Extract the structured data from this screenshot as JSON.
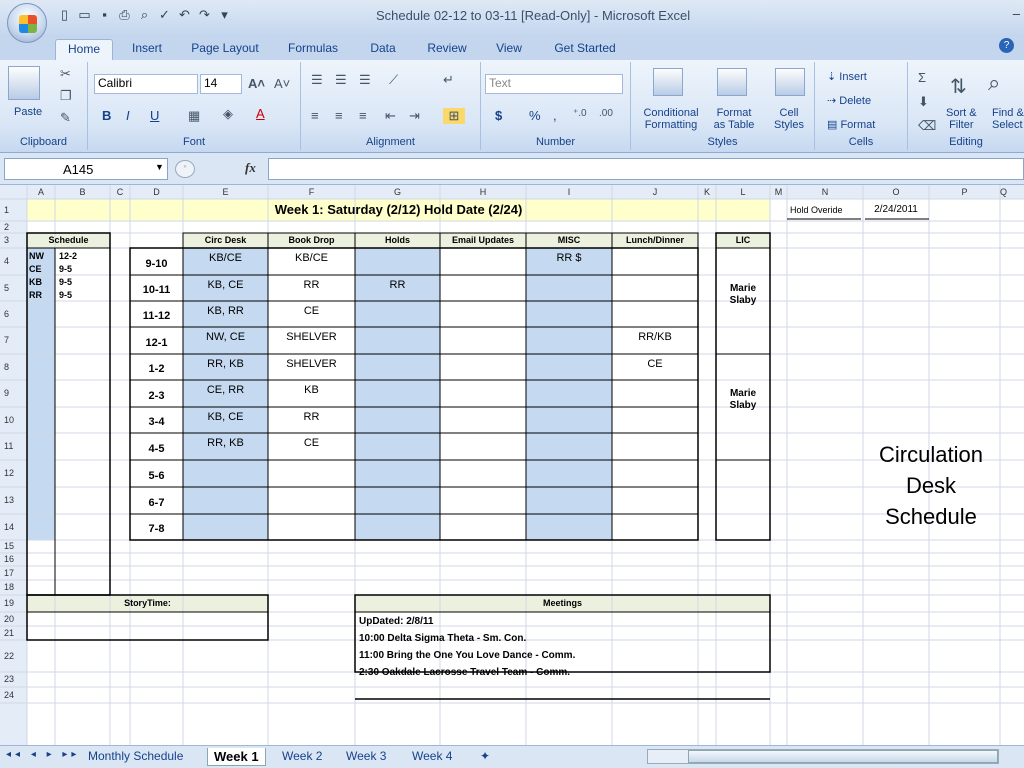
{
  "window": {
    "title": "Schedule 02-12 to 03-11  [Read-Only] - Microsoft Excel",
    "min": "–"
  },
  "tabs": [
    "Home",
    "Insert",
    "Page Layout",
    "Formulas",
    "Data",
    "Review",
    "View",
    "Get Started"
  ],
  "ribbon": {
    "clipboard": {
      "label": "Clipboard",
      "paste": "Paste"
    },
    "font": {
      "label": "Font",
      "name": "Calibri",
      "size": "14",
      "bold": "B",
      "italic": "I",
      "underline": "U"
    },
    "alignment": {
      "label": "Alignment"
    },
    "number": {
      "label": "Number",
      "format": "Text",
      "currency": "$",
      "percent": "%",
      "comma": ","
    },
    "styles": {
      "label": "Styles",
      "conditional": [
        "Conditional",
        "Formatting"
      ],
      "format_table": [
        "Format",
        "as Table"
      ],
      "cell_styles": [
        "Cell",
        "Styles"
      ]
    },
    "cells": {
      "label": "Cells",
      "insert": "Insert",
      "delete": "Delete",
      "format": "Format"
    },
    "editing": {
      "label": "Editing",
      "sort": [
        "Sort &",
        "Filter"
      ],
      "find": [
        "Find &",
        "Select"
      ]
    }
  },
  "formula_bar": {
    "name_box": "A145",
    "fx": "fx",
    "content": ""
  },
  "columns": [
    "A",
    "B",
    "C",
    "D",
    "E",
    "F",
    "G",
    "H",
    "I",
    "J",
    "K",
    "L",
    "M",
    "N",
    "O",
    "P",
    "Q"
  ],
  "rows": [
    "1",
    "2",
    "3",
    "4",
    "5",
    "6",
    "7",
    "8",
    "9",
    "10",
    "11",
    "12",
    "13",
    "14",
    "15",
    "16",
    "17",
    "18",
    "19",
    "20",
    "21",
    "22",
    "23",
    "24"
  ],
  "sheet": {
    "title": "Week 1: Saturday (2/12)   Hold Date (2/24)",
    "hold_override_label": "Hold Overide",
    "hold_override_value": "2/24/2011",
    "schedule_header": "Schedule",
    "staff": [
      [
        "NW",
        "12-2"
      ],
      [
        "CE",
        "9-5"
      ],
      [
        "KB",
        "9-5"
      ],
      [
        "RR",
        "9-5"
      ]
    ],
    "headers": [
      "Circ Desk",
      "Book Drop",
      "Holds",
      "Email Updates",
      "MISC",
      "Lunch/Dinner"
    ],
    "lic_header": "LIC",
    "times": [
      "9-10",
      "10-11",
      "11-12",
      "12-1",
      "1-2",
      "2-3",
      "3-4",
      "4-5",
      "5-6",
      "6-7",
      "7-8"
    ],
    "circ": [
      "KB/CE",
      "KB, CE",
      "KB, RR",
      "NW, CE",
      "RR, KB",
      "CE, RR",
      "KB, CE",
      "RR, KB",
      "",
      "",
      ""
    ],
    "book_drop": [
      "KB/CE",
      "RR",
      "CE",
      "SHELVER",
      "SHELVER",
      "KB",
      "RR",
      "CE",
      "",
      "",
      ""
    ],
    "holds": [
      "",
      "RR",
      "",
      "",
      "",
      "",
      "",
      "",
      "",
      "",
      ""
    ],
    "misc": [
      "RR $",
      "",
      "",
      "",
      "",
      "",
      "",
      "",
      "",
      "",
      ""
    ],
    "lunch": [
      "",
      "",
      "",
      "RR/KB",
      "CE",
      "",
      "",
      "",
      "",
      "",
      ""
    ],
    "lic_1": [
      "Marie",
      "Slaby"
    ],
    "lic_2": [
      "Marie",
      "Slaby"
    ],
    "storytime_header": "StoryTime:",
    "meetings_header": "Meetings",
    "meetings": [
      "UpDated: 2/8/11",
      "10:00 Delta Sigma Theta - Sm. Con.",
      "11:00 Bring the One You Love Dance - Comm.",
      "2:30 Oakdale Lacrosse Travel Team - Comm."
    ],
    "side_label": [
      "Circulation",
      "Desk",
      "Schedule"
    ]
  },
  "sheet_tabs": [
    "Monthly Schedule",
    "Week 1",
    "Week 2",
    "Week 3",
    "Week 4"
  ],
  "colors": {
    "yellow": "#ffffcc",
    "header_green": "#ebf1de",
    "blue": "#c5d9f1",
    "grid": "#d0d7e5",
    "header_bg": "#e4ecf7"
  }
}
